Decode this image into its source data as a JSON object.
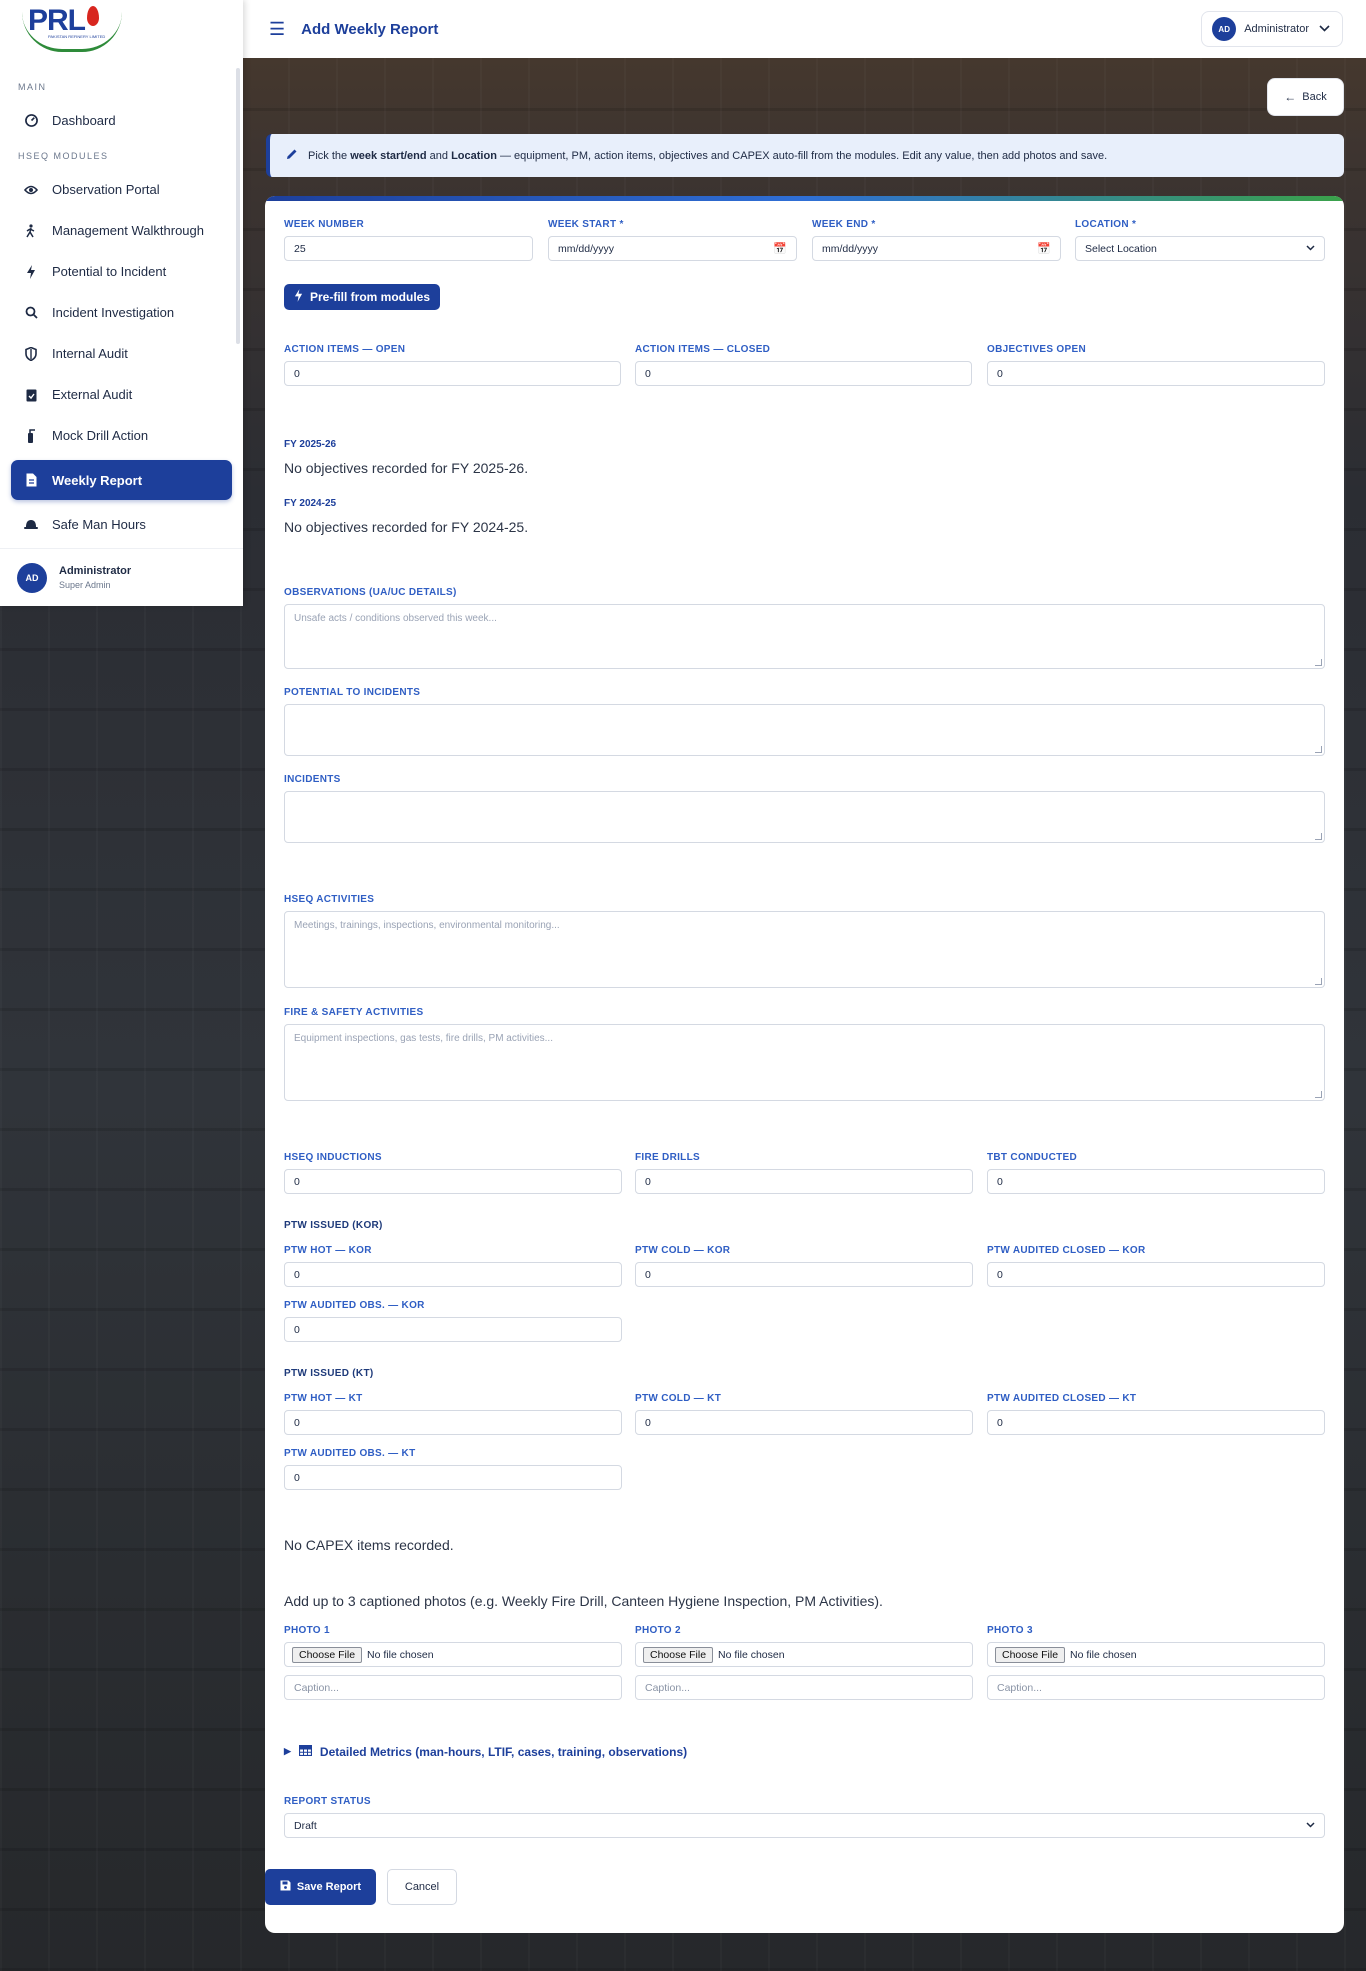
{
  "brand": {
    "logo_text": "PRL",
    "logo_sub": "PAKISTAN REFINERY LIMITED"
  },
  "sidebar": {
    "section_main": "MAIN",
    "section_modules": "HSEQ MODULES",
    "items": [
      {
        "label": "Dashboard",
        "icon": "dashboard-icon"
      },
      {
        "label": "Observation Portal",
        "icon": "eye-icon"
      },
      {
        "label": "Management Walkthrough",
        "icon": "walking-icon"
      },
      {
        "label": "Potential to Incident",
        "icon": "bolt-icon"
      },
      {
        "label": "Incident Investigation",
        "icon": "search-icon"
      },
      {
        "label": "Internal Audit",
        "icon": "shield-icon"
      },
      {
        "label": "External Audit",
        "icon": "clipboard-check-icon"
      },
      {
        "label": "Mock Drill Action",
        "icon": "fire-extinguisher-icon"
      },
      {
        "label": "Weekly Report",
        "icon": "file-icon",
        "active": true
      },
      {
        "label": "Safe Man Hours",
        "icon": "hard-hat-icon"
      }
    ],
    "user": {
      "initials": "AD",
      "name": "Administrator",
      "role": "Super Admin"
    }
  },
  "header": {
    "title": "Add Weekly Report",
    "user_initials": "AD",
    "user_name": "Administrator"
  },
  "back_label": "Back",
  "banner": {
    "pre": "Pick the ",
    "b1": "week start/end",
    "mid": " and ",
    "b2": "Location",
    "post": " — equipment, PM, action items, objectives and CAPEX auto-fill from the modules. Edit any value, then add photos and save."
  },
  "form": {
    "week_number": {
      "label": "WEEK NUMBER",
      "value": "25"
    },
    "week_start": {
      "label": "WEEK START *",
      "value": "mm/dd/yyyy"
    },
    "week_end": {
      "label": "WEEK END *",
      "value": "mm/dd/yyyy"
    },
    "location": {
      "label": "LOCATION *",
      "value": "Select Location"
    },
    "prefill_label": "Pre-fill from modules",
    "action_open": {
      "label": "ACTION ITEMS — OPEN",
      "value": "0"
    },
    "action_closed": {
      "label": "ACTION ITEMS — CLOSED",
      "value": "0"
    },
    "objectives_open": {
      "label": "OBJECTIVES OPEN",
      "value": "0"
    },
    "fy1": {
      "label": "FY 2025-26",
      "text": "No objectives recorded for FY 2025-26."
    },
    "fy2": {
      "label": "FY 2024-25",
      "text": "No objectives recorded for FY 2024-25."
    },
    "observations": {
      "label": "OBSERVATIONS (UA/UC DETAILS)",
      "placeholder": "Unsafe acts / conditions observed this week..."
    },
    "potential": {
      "label": "POTENTIAL TO INCIDENTS",
      "placeholder": ""
    },
    "incidents": {
      "label": "INCIDENTS",
      "placeholder": ""
    },
    "hseq_activities": {
      "label": "HSEQ ACTIVITIES",
      "placeholder": "Meetings, trainings, inspections, environmental monitoring..."
    },
    "fire_safety": {
      "label": "FIRE & SAFETY ACTIVITIES",
      "placeholder": "Equipment inspections, gas tests, fire drills, PM activities..."
    },
    "hseq_inductions": {
      "label": "HSEQ INDUCTIONS",
      "value": "0"
    },
    "fire_drills": {
      "label": "FIRE DRILLS",
      "value": "0"
    },
    "tbt_conducted": {
      "label": "TBT CONDUCTED",
      "value": "0"
    },
    "ptw_kor_heading": "PTW ISSUED (KOR)",
    "ptw_hot_kor": {
      "label": "PTW HOT — KOR",
      "value": "0"
    },
    "ptw_cold_kor": {
      "label": "PTW COLD — KOR",
      "value": "0"
    },
    "ptw_audited_closed_kor": {
      "label": "PTW AUDITED CLOSED — KOR",
      "value": "0"
    },
    "ptw_audited_obs_kor": {
      "label": "PTW AUDITED OBS. — KOR",
      "value": "0"
    },
    "ptw_kt_heading": "PTW ISSUED (KT)",
    "ptw_hot_kt": {
      "label": "PTW HOT — KT",
      "value": "0"
    },
    "ptw_cold_kt": {
      "label": "PTW COLD — KT",
      "value": "0"
    },
    "ptw_audited_closed_kt": {
      "label": "PTW AUDITED CLOSED — KT",
      "value": "0"
    },
    "ptw_audited_obs_kt": {
      "label": "PTW AUDITED OBS. — KT",
      "value": "0"
    },
    "capex_text": "No CAPEX items recorded.",
    "photos_text": "Add up to 3 captioned photos (e.g. Weekly Fire Drill, Canteen Hygiene Inspection, PM Activities).",
    "photos": [
      {
        "label": "PHOTO 1",
        "button": "Choose File",
        "status": "No file chosen",
        "caption_placeholder": "Caption..."
      },
      {
        "label": "PHOTO 2",
        "button": "Choose File",
        "status": "No file chosen",
        "caption_placeholder": "Caption..."
      },
      {
        "label": "PHOTO 3",
        "button": "Choose File",
        "status": "No file chosen",
        "caption_placeholder": "Caption..."
      }
    ],
    "details_label": "Detailed Metrics (man-hours, LTIF, cases, training, observations)",
    "report_status": {
      "label": "REPORT STATUS",
      "value": "Draft"
    },
    "save_label": "Save Report",
    "cancel_label": "Cancel"
  },
  "colors": {
    "primary": "#1d3f9b",
    "label_blue": "#2f5ec4",
    "banner_bg": "#e8effb",
    "stripe_green": "#3aa24a"
  }
}
